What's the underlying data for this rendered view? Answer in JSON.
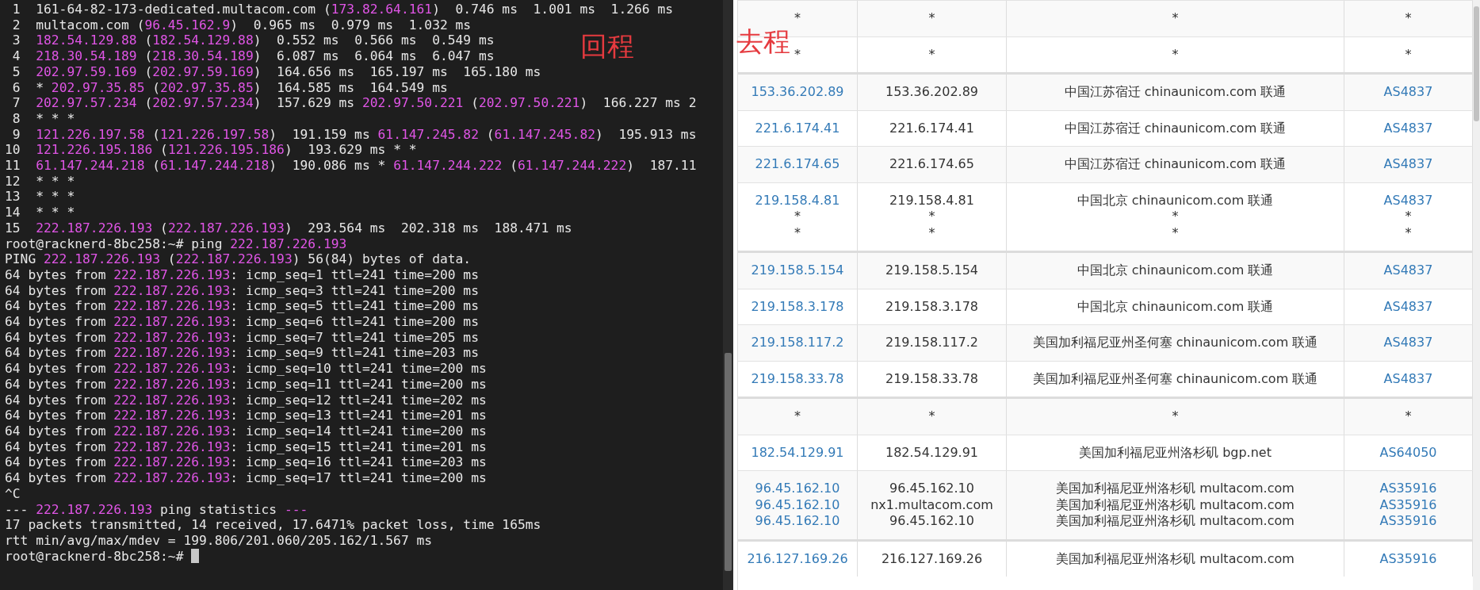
{
  "terminal": {
    "label": "回程",
    "lines": [
      {
        "parts": [
          " 1  161-64-82-173-dedicated.multacom.com (",
          "173.82.64.161",
          ")  0.746 ms  1.001 ms  1.266 ms"
        ]
      },
      {
        "parts": [
          " 2  multacom.com (",
          "96.45.162.9",
          ")  0.965 ms  0.979 ms  1.032 ms"
        ]
      },
      {
        "parts": [
          " 3  ",
          "182.54.129.88",
          " (",
          "182.54.129.88",
          ")  0.552 ms  0.566 ms  0.549 ms"
        ]
      },
      {
        "parts": [
          " 4  ",
          "218.30.54.189",
          " (",
          "218.30.54.189",
          ")  6.087 ms  6.064 ms  6.047 ms"
        ]
      },
      {
        "parts": [
          " 5  ",
          "202.97.59.169",
          " (",
          "202.97.59.169",
          ")  164.656 ms  165.197 ms  165.180 ms"
        ]
      },
      {
        "parts": [
          " 6  * ",
          "202.97.35.85",
          " (",
          "202.97.35.85",
          ")  164.585 ms  164.549 ms"
        ]
      },
      {
        "parts": [
          " 7  ",
          "202.97.57.234",
          " (",
          "202.97.57.234",
          ")  157.629 ms ",
          "202.97.50.221",
          " (",
          "202.97.50.221",
          ")  166.227 ms 2"
        ]
      },
      {
        "parts": [
          " 8  * * *"
        ]
      },
      {
        "parts": [
          " 9  ",
          "121.226.197.58",
          " (",
          "121.226.197.58",
          ")  191.159 ms ",
          "61.147.245.82",
          " (",
          "61.147.245.82",
          ")  195.913 ms"
        ]
      },
      {
        "parts": [
          "10  ",
          "121.226.195.186",
          " (",
          "121.226.195.186",
          ")  193.629 ms * *"
        ]
      },
      {
        "parts": [
          "11  ",
          "61.147.244.218",
          " (",
          "61.147.244.218",
          ")  190.086 ms * ",
          "61.147.244.222",
          " (",
          "61.147.244.222",
          ")  187.11"
        ]
      },
      {
        "parts": [
          "12  * * *"
        ]
      },
      {
        "parts": [
          "13  * * *"
        ]
      },
      {
        "parts": [
          "14  * * *"
        ]
      },
      {
        "parts": [
          "15  ",
          "222.187.226.193",
          " (",
          "222.187.226.193",
          ")  293.564 ms  202.318 ms  188.471 ms"
        ]
      },
      {
        "parts": [
          "root@racknerd-8bc258:~# ping ",
          "222.187.226.193"
        ]
      },
      {
        "parts": [
          "PING ",
          "222.187.226.193",
          " (",
          "222.187.226.193",
          ") 56(84) bytes of data."
        ]
      },
      {
        "parts": [
          "64 bytes from ",
          "222.187.226.193",
          ": icmp_seq=1 ttl=241 time=200 ms"
        ]
      },
      {
        "parts": [
          "64 bytes from ",
          "222.187.226.193",
          ": icmp_seq=3 ttl=241 time=200 ms"
        ]
      },
      {
        "parts": [
          "64 bytes from ",
          "222.187.226.193",
          ": icmp_seq=5 ttl=241 time=200 ms"
        ]
      },
      {
        "parts": [
          "64 bytes from ",
          "222.187.226.193",
          ": icmp_seq=6 ttl=241 time=200 ms"
        ]
      },
      {
        "parts": [
          "64 bytes from ",
          "222.187.226.193",
          ": icmp_seq=7 ttl=241 time=205 ms"
        ]
      },
      {
        "parts": [
          "64 bytes from ",
          "222.187.226.193",
          ": icmp_seq=9 ttl=241 time=203 ms"
        ]
      },
      {
        "parts": [
          "64 bytes from ",
          "222.187.226.193",
          ": icmp_seq=10 ttl=241 time=200 ms"
        ]
      },
      {
        "parts": [
          "64 bytes from ",
          "222.187.226.193",
          ": icmp_seq=11 ttl=241 time=200 ms"
        ]
      },
      {
        "parts": [
          "64 bytes from ",
          "222.187.226.193",
          ": icmp_seq=12 ttl=241 time=202 ms"
        ]
      },
      {
        "parts": [
          "64 bytes from ",
          "222.187.226.193",
          ": icmp_seq=13 ttl=241 time=201 ms"
        ]
      },
      {
        "parts": [
          "64 bytes from ",
          "222.187.226.193",
          ": icmp_seq=14 ttl=241 time=200 ms"
        ]
      },
      {
        "parts": [
          "64 bytes from ",
          "222.187.226.193",
          ": icmp_seq=15 ttl=241 time=201 ms"
        ]
      },
      {
        "parts": [
          "64 bytes from ",
          "222.187.226.193",
          ": icmp_seq=16 ttl=241 time=203 ms"
        ]
      },
      {
        "parts": [
          "64 bytes from ",
          "222.187.226.193",
          ": icmp_seq=17 ttl=241 time=200 ms"
        ]
      },
      {
        "parts": [
          "^C"
        ]
      },
      {
        "parts": [
          "--- ",
          "222.187.226.193",
          " ping statistics ",
          "---"
        ]
      },
      {
        "parts": [
          "17 packets transmitted, 14 received, 17.6471% packet loss, time 165ms"
        ]
      },
      {
        "parts": [
          "rtt min/avg/max/mdev = 199.806/201.060/205.162/1.567 ms"
        ]
      },
      {
        "parts": [
          "root@racknerd-8bc258:~# "
        ],
        "cursor": true
      }
    ]
  },
  "route_table": {
    "label": "去程",
    "rows": [
      {
        "group_start": false,
        "entries": [
          {
            "kind": "timeout",
            "ip": "*",
            "host": "*",
            "location": "*",
            "asn": "*"
          }
        ]
      },
      {
        "group_start": false,
        "entries": [
          {
            "kind": "timeout",
            "ip": "*",
            "host": "*",
            "location": "*",
            "asn": "*"
          }
        ]
      },
      {
        "group_start": true,
        "entries": [
          {
            "kind": "hop",
            "ip": "153.36.202.89",
            "host": "153.36.202.89",
            "location": "中国江苏宿迁 chinaunicom.com 联通",
            "asn": "AS4837"
          }
        ]
      },
      {
        "group_start": false,
        "entries": [
          {
            "kind": "hop",
            "ip": "221.6.174.41",
            "host": "221.6.174.41",
            "location": "中国江苏宿迁 chinaunicom.com 联通",
            "asn": "AS4837"
          }
        ]
      },
      {
        "group_start": false,
        "entries": [
          {
            "kind": "hop",
            "ip": "221.6.174.65",
            "host": "221.6.174.65",
            "location": "中国江苏宿迁 chinaunicom.com 联通",
            "asn": "AS4837"
          }
        ]
      },
      {
        "group_start": false,
        "entries": [
          {
            "kind": "hop",
            "ip": "219.158.4.81",
            "host": "219.158.4.81",
            "location": "中国北京 chinaunicom.com 联通",
            "asn": "AS4837"
          },
          {
            "kind": "timeout",
            "ip": "*",
            "host": "*",
            "location": "*",
            "asn": "*"
          },
          {
            "kind": "timeout",
            "ip": "*",
            "host": "*",
            "location": "*",
            "asn": "*"
          }
        ]
      },
      {
        "group_start": true,
        "entries": [
          {
            "kind": "hop",
            "ip": "219.158.5.154",
            "host": "219.158.5.154",
            "location": "中国北京 chinaunicom.com 联通",
            "asn": "AS4837"
          }
        ]
      },
      {
        "group_start": false,
        "entries": [
          {
            "kind": "hop",
            "ip": "219.158.3.178",
            "host": "219.158.3.178",
            "location": "中国北京 chinaunicom.com 联通",
            "asn": "AS4837"
          }
        ]
      },
      {
        "group_start": false,
        "entries": [
          {
            "kind": "hop",
            "ip": "219.158.117.2",
            "host": "219.158.117.2",
            "location": "美国加利福尼亚州圣何塞 chinaunicom.com 联通",
            "asn": "AS4837"
          }
        ]
      },
      {
        "group_start": false,
        "entries": [
          {
            "kind": "hop",
            "ip": "219.158.33.78",
            "host": "219.158.33.78",
            "location": "美国加利福尼亚州圣何塞 chinaunicom.com 联通",
            "asn": "AS4837"
          }
        ]
      },
      {
        "group_start": true,
        "entries": [
          {
            "kind": "timeout",
            "ip": "*",
            "host": "*",
            "location": "*",
            "asn": "*"
          }
        ]
      },
      {
        "group_start": false,
        "entries": [
          {
            "kind": "hop",
            "ip": "182.54.129.91",
            "host": "182.54.129.91",
            "location": "美国加利福尼亚州洛杉矶 bgp.net",
            "asn": "AS64050"
          }
        ]
      },
      {
        "group_start": false,
        "entries": [
          {
            "kind": "hop",
            "ip": "96.45.162.10",
            "host": "96.45.162.10",
            "location": "美国加利福尼亚州洛杉矶 multacom.com",
            "asn": "AS35916"
          },
          {
            "kind": "hop",
            "ip": "96.45.162.10",
            "host": "nx1.multacom.com",
            "location": "美国加利福尼亚州洛杉矶 multacom.com",
            "asn": "AS35916"
          },
          {
            "kind": "hop",
            "ip": "96.45.162.10",
            "host": "96.45.162.10",
            "location": "美国加利福尼亚州洛杉矶 multacom.com",
            "asn": "AS35916"
          }
        ]
      },
      {
        "group_start": true,
        "entries": [
          {
            "kind": "hop",
            "ip": "216.127.169.26",
            "host": "216.127.169.26",
            "location": "美国加利福尼亚州洛杉矶 multacom.com",
            "asn": "AS35916"
          }
        ]
      }
    ]
  }
}
